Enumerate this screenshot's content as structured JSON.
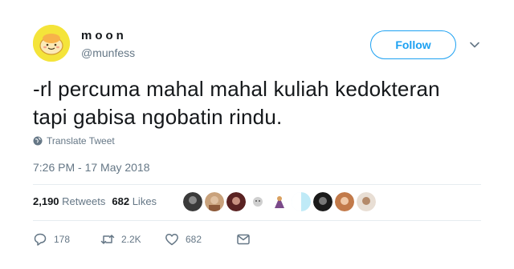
{
  "author": {
    "display_name": "moon",
    "username": "@munfess",
    "avatar_icon": "cartoon-egg-avatar"
  },
  "follow_label": "Follow",
  "tweet": {
    "text_line1": "-rl percuma mahal mahal kuliah kedokteran",
    "text_line2": "tapi gabisa ngobatin rindu."
  },
  "translate_label": "Translate Tweet",
  "timestamp": "7:26 PM - 17 May 2018",
  "stats": {
    "retweets_count": "2,190",
    "retweets_label": "Retweets",
    "likes_count": "682",
    "likes_label": "Likes"
  },
  "actions": {
    "replies": "178",
    "retweets": "2.2K",
    "likes": "682"
  },
  "colors": {
    "accent": "#1da1f2",
    "secondary_text": "#657786",
    "avatar_bg": "#f4e43a"
  }
}
